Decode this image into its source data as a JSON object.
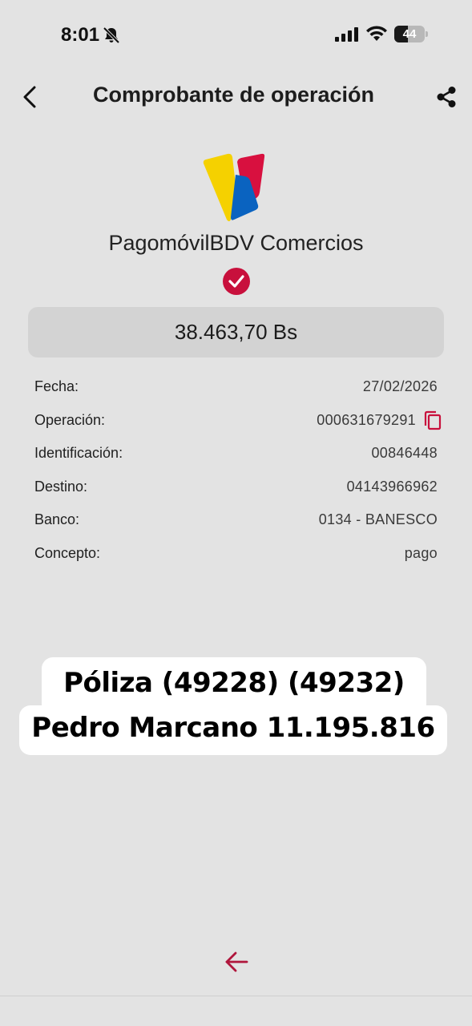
{
  "status_bar": {
    "time": "8:01",
    "battery_level": "44",
    "battery_fraction": 0.44,
    "icons": [
      "bell-slash-icon",
      "cellular-signal-icon",
      "wifi-icon",
      "battery-icon"
    ]
  },
  "header": {
    "title": "Comprobante de operación",
    "back_icon": "chevron-left-icon",
    "share_icon": "share-icon"
  },
  "brand": {
    "name": "PagomóvilBDV Comercios",
    "logo_colors": [
      "#f5d100",
      "#0a63c0",
      "#d8103f"
    ],
    "success_icon": "check-circle-icon"
  },
  "amount": "38.463,70 Bs",
  "details": [
    {
      "label": "Fecha:",
      "value": "27/02/2026"
    },
    {
      "label": "Operación:",
      "value": "000631679291"
    },
    {
      "label": "Identificación:",
      "value": "00846448"
    },
    {
      "label": "Destino:",
      "value": "04143966962"
    },
    {
      "label": "Banco:",
      "value": "0134 - BANESCO"
    },
    {
      "label": "Concepto:",
      "value": "pago"
    }
  ],
  "caption": {
    "line1": "Póliza (49228) (49232)",
    "line2": "Pedro Marcano 11.195.816"
  },
  "footer": {
    "back_arrow_icon": "arrow-left-icon"
  },
  "colors": {
    "accent": "#c8103c",
    "background": "#e3e3e3",
    "amount_box": "#d3d3d3"
  }
}
